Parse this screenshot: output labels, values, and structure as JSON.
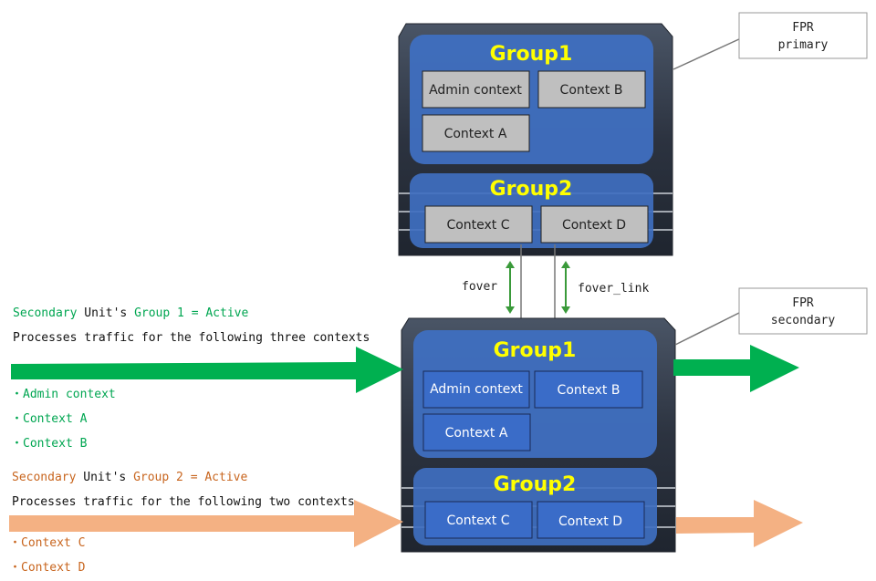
{
  "colors": {
    "group1_active": "#00a651",
    "group2_active": "#c8651e",
    "arrow_group2": "#f4b183",
    "group_box": "#3f6fc0",
    "context_primary": "#bfbfbf",
    "context_secondary": "#3a6cc8",
    "title": "#ffff00"
  },
  "primary": {
    "label_line1": "FPR",
    "label_line2": "primary",
    "group1": {
      "title": "Group1",
      "contexts": [
        "Admin context",
        "Context B",
        "Context A"
      ]
    },
    "group2": {
      "title": "Group2",
      "contexts": [
        "Context C",
        "Context D"
      ]
    }
  },
  "secondary": {
    "label_line1": "FPR",
    "label_line2": "secondary",
    "group1": {
      "title": "Group1",
      "contexts": [
        "Admin context",
        "Context B",
        "Context A"
      ]
    },
    "group2": {
      "title": "Group2",
      "contexts": [
        "Context C",
        "Context D"
      ]
    }
  },
  "links": {
    "fover": "fover",
    "fover_link": "fover_link"
  },
  "notes": {
    "group1": {
      "unit": "Secondary",
      "mid": " Unit's ",
      "group": "Group 1 = Active",
      "desc": "Processes traffic for the following three contexts",
      "items": [
        "・Admin context",
        "・Context A",
        "・Context B"
      ]
    },
    "group2": {
      "unit": "Secondary",
      "mid": " Unit's ",
      "group": "Group 2 = Active",
      "desc": "Processes traffic for the following two contexts",
      "items": [
        "・Context C",
        "・Context D"
      ]
    }
  }
}
